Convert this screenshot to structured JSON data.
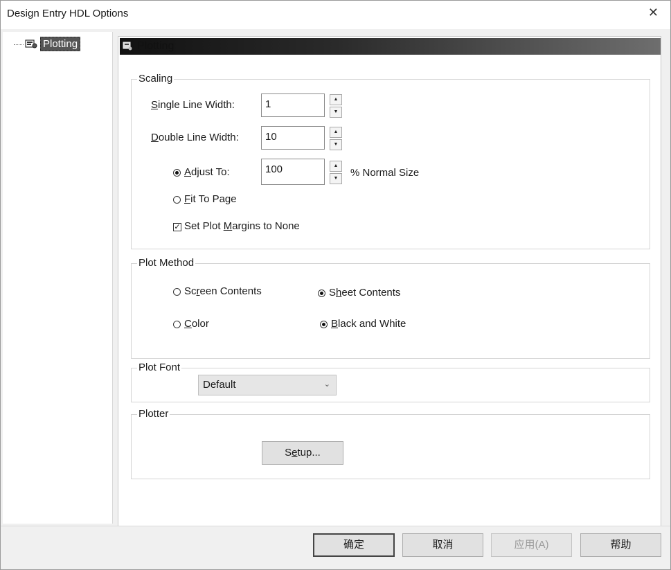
{
  "window": {
    "title": "Design Entry HDL Options",
    "close_glyph": "✕"
  },
  "tree": {
    "items": [
      {
        "label": "Plotting",
        "icon": "plot-settings-icon"
      }
    ]
  },
  "panel": {
    "header": "Plotting",
    "scaling": {
      "legend": "Scaling",
      "single_line": {
        "label_ul": "S",
        "label_rest": "ingle Line Width:",
        "value": "1"
      },
      "double_line": {
        "label_ul": "D",
        "label_rest": "ouble Line Width:",
        "value": "10"
      },
      "adjust_to": {
        "label_ul": "A",
        "label_rest": "djust To:",
        "value": "100",
        "suffix": "% Normal Size",
        "selected": true
      },
      "fit_to_page": {
        "label_ul": "F",
        "label_rest": "it To Page",
        "selected": false
      },
      "margins": {
        "label_pre": "Set Plot ",
        "label_ul": "M",
        "label_rest": "argins to None",
        "checked": true
      }
    },
    "plot_method": {
      "legend": "Plot Method",
      "screen_contents": {
        "pre": "Sc",
        "ul": "r",
        "rest": "een Contents",
        "selected": false
      },
      "sheet_contents": {
        "pre": "S",
        "ul": "h",
        "rest": "eet Contents",
        "selected": true
      },
      "color": {
        "pre": "",
        "ul": "C",
        "rest": "olor",
        "selected": false
      },
      "black_white": {
        "pre": "",
        "ul": "B",
        "rest": "lack and White",
        "selected": true
      }
    },
    "plot_font": {
      "legend": "Plot Font",
      "selected": "Default"
    },
    "plotter": {
      "legend": "Plotter",
      "setup": {
        "pre": "S",
        "ul": "e",
        "rest": "tup..."
      }
    }
  },
  "footer": {
    "ok": "确定",
    "cancel": "取消",
    "apply": "应用(A)",
    "help": "帮助"
  },
  "colors": {
    "banner_dark": "#111111",
    "banner_light": "#6e6e6e",
    "selection": "#555555"
  }
}
